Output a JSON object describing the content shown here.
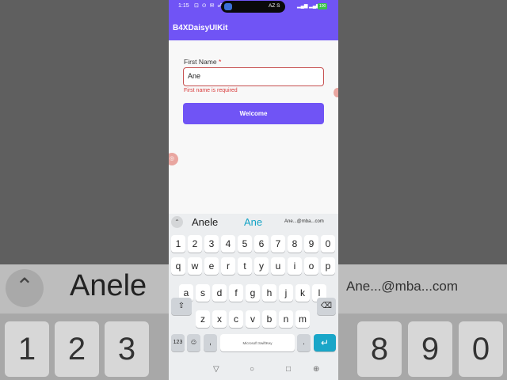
{
  "status_bar": {
    "time": "1:15",
    "left_icons": "⊡ ⊙ ✉ ☍",
    "carrier_text": "AZ S",
    "signal_icons": "▂▄▆ ▂▄▆",
    "battery": "100"
  },
  "app_bar": {
    "title": "B4XDaisyUIKit"
  },
  "form": {
    "label": "First Name",
    "required_mark": "*",
    "input_value": "Ane",
    "error_text": "First name is required",
    "button_label": "Welcome"
  },
  "keyboard": {
    "suggestions": [
      "Anele",
      "Ane",
      "Ane...@mba...com"
    ],
    "number_row": [
      "1",
      "2",
      "3",
      "4",
      "5",
      "6",
      "7",
      "8",
      "9",
      "0"
    ],
    "row1": [
      "q",
      "w",
      "e",
      "r",
      "t",
      "y",
      "u",
      "i",
      "o",
      "p"
    ],
    "row2": [
      "a",
      "s",
      "d",
      "f",
      "g",
      "h",
      "j",
      "k",
      "l"
    ],
    "row3": [
      "z",
      "x",
      "c",
      "v",
      "b",
      "n",
      "m"
    ],
    "symbols_label": "123",
    "emoji_icon": "☺",
    "comma_label": ",",
    "period_label": ".",
    "space_label": "Microsoft SwiftKey",
    "shift_icon": "⇧",
    "backspace_icon": "⌫",
    "enter_icon": "↵"
  },
  "nav_bar": {
    "back_icon": "▽",
    "home_icon": "○",
    "recents_icon": "□",
    "globe_icon": "⊕"
  },
  "backdrop": {
    "suggestion_left": "Anele",
    "suggestion_right": "Ane...@mba...com",
    "keys_left": [
      "1",
      "2",
      "3"
    ],
    "keys_right": [
      "8",
      "9",
      "0"
    ]
  }
}
